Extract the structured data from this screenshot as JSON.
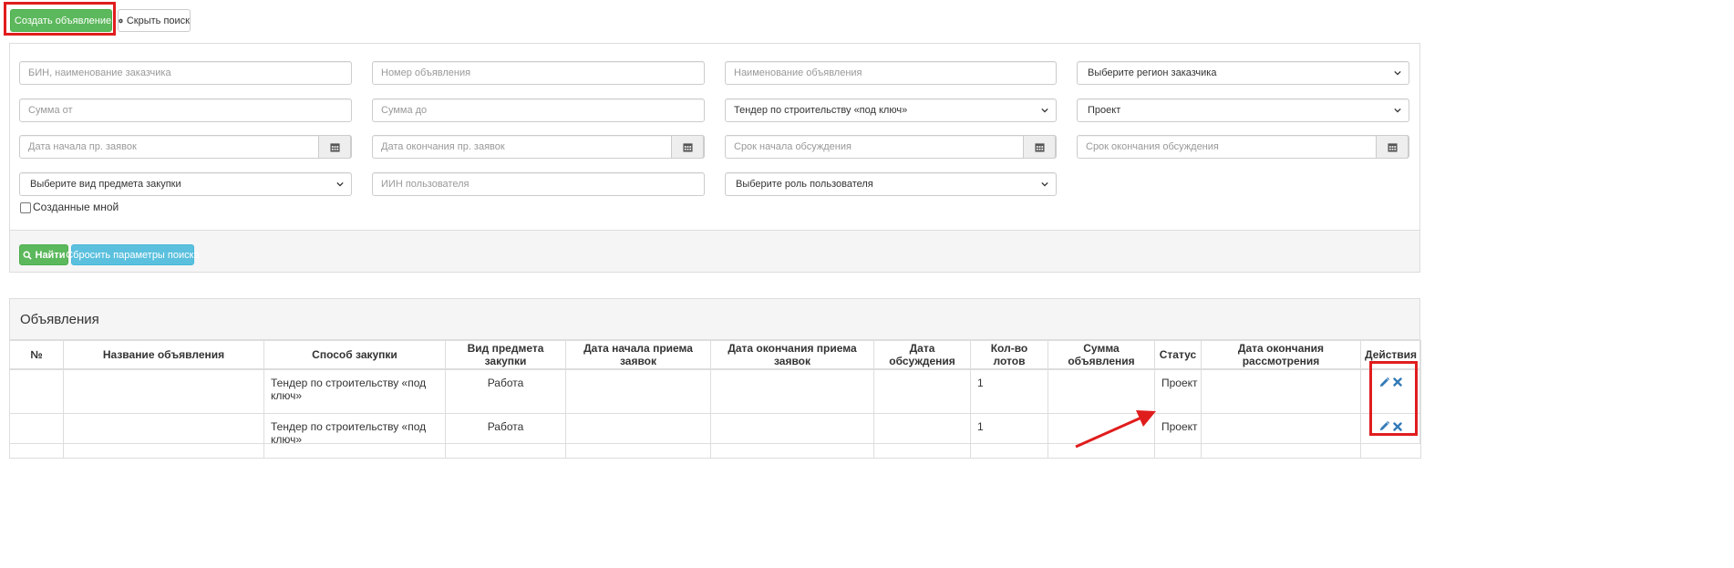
{
  "toolbar": {
    "create_label": "Создать объявление",
    "hide_search_label": "Скрыть поиск"
  },
  "search": {
    "customer_placeholder": "БИН, наименование заказчика",
    "number_placeholder": "Номер объявления",
    "name_placeholder": "Наименование объявления",
    "region_value": "Выберите регион заказчика",
    "sum_from_placeholder": "Сумма от",
    "sum_to_placeholder": "Сумма до",
    "method_value": "Тендер по строительству «под ключ»",
    "status_value": "Проект",
    "start_date_placeholder": "Дата начала пр. заявок",
    "end_date_placeholder": "Дата окончания пр. заявок",
    "discussion_start_placeholder": "Срок начала обсуждения",
    "discussion_end_placeholder": "Срок окончания обсуждения",
    "subject_type_value": "Выберите вид предмета закупки",
    "user_iin_placeholder": "ИИН пользователя",
    "user_role_value": "Выберите роль пользователя",
    "created_by_me_label": "Созданные мной",
    "find_label": "Найти",
    "reset_label": "Сбросить параметры поиска"
  },
  "results": {
    "title": "Объявления",
    "columns": [
      "№",
      "Название объявления",
      "Способ закупки",
      "Вид предмета закупки",
      "Дата начала приема заявок",
      "Дата окончания приема заявок",
      "Дата обсуждения",
      "Кол-во лотов",
      "Сумма объявления",
      "Статус",
      "Дата окончания рассмотрения",
      "Действия"
    ],
    "rows": [
      {
        "num": "",
        "name": "",
        "method": "Тендер по строительству «под ключ»",
        "subject_type": "Работа",
        "start_date": "",
        "end_date": "",
        "discussion_date": "",
        "lots": "1",
        "sum": "",
        "status": "Проект",
        "review_end": ""
      },
      {
        "num": "",
        "name": "",
        "method": "Тендер по строительству «под ключ»",
        "subject_type": "Работа",
        "start_date": "",
        "end_date": "",
        "discussion_date": "",
        "lots": "1",
        "sum": "",
        "status": "Проект",
        "review_end": ""
      }
    ]
  },
  "icons": {
    "plus": "plus-icon",
    "gear": "gear-icon",
    "search": "search-icon",
    "calendar": "calendar-icon",
    "edit": "pencil-icon",
    "delete": "close-icon"
  },
  "colors": {
    "success": "#5cb85c",
    "info": "#5bc0de",
    "annotation": "#e01d1d",
    "action_icon": "#337ab7"
  }
}
